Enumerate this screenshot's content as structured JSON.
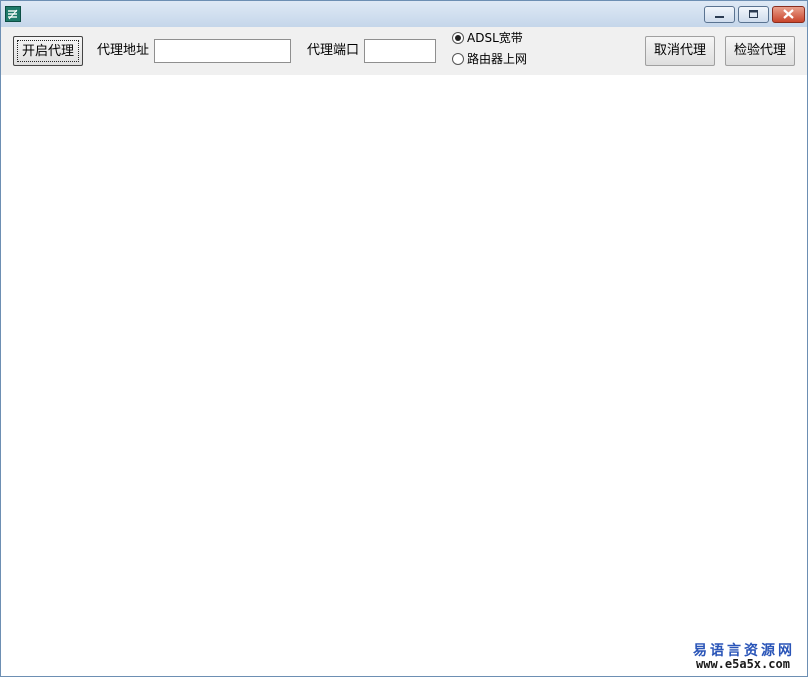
{
  "window": {
    "app_icon": "easy-language-app-icon",
    "controls": {
      "minimize": "minimize-icon",
      "maximize": "maximize-icon",
      "close": "close-icon"
    }
  },
  "toolbar": {
    "start_proxy_label": "开启代理",
    "proxy_address_label": "代理地址",
    "proxy_address_value": "",
    "proxy_port_label": "代理端口",
    "proxy_port_value": "",
    "connection_options": [
      {
        "label": "ADSL宽带",
        "selected": true
      },
      {
        "label": "路由器上网",
        "selected": false
      }
    ],
    "cancel_proxy_label": "取消代理",
    "check_proxy_label": "检验代理"
  },
  "watermark": {
    "line1": "易语言资源网",
    "line2": "www.e5a5x.com"
  },
  "colors": {
    "titlebar": "#c5d6ea",
    "toolbar": "#f0f0f0",
    "close_button": "#c9452c",
    "watermark_blue": "#2a55b8"
  }
}
